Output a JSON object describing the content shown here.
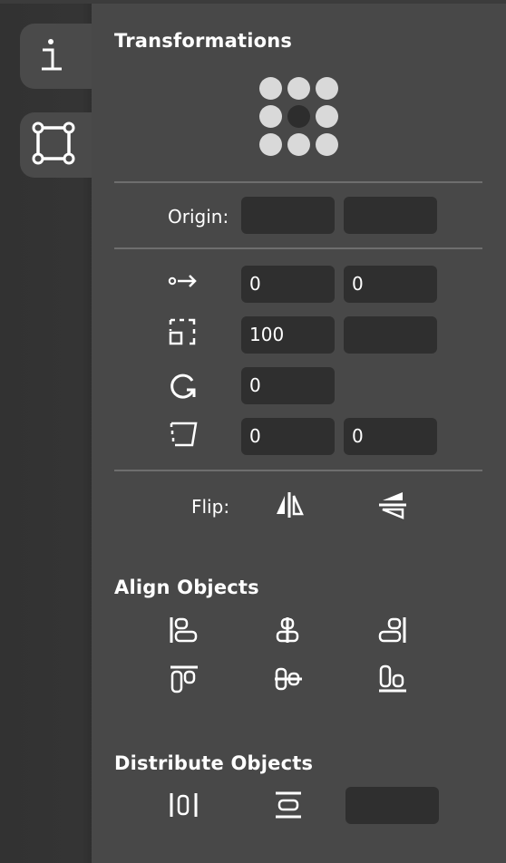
{
  "sidebar": {
    "tabs": [
      {
        "name": "info",
        "icon": "info-icon"
      },
      {
        "name": "transform",
        "icon": "transform-box-icon",
        "active": true
      }
    ]
  },
  "transformations": {
    "heading": "Transformations",
    "anchor_grid": {
      "selected": "center"
    },
    "origin": {
      "label": "Origin:",
      "x": "",
      "y": ""
    },
    "position": {
      "icon": "position-arrow-icon",
      "x": "0",
      "y": "0"
    },
    "scale": {
      "icon": "scale-icon",
      "width": "100",
      "height": ""
    },
    "rotate": {
      "icon": "rotate-icon",
      "value": "0"
    },
    "skew": {
      "icon": "skew-icon",
      "x": "0",
      "y": "0"
    },
    "flip": {
      "label": "Flip:",
      "horizontal_icon": "flip-horizontal-icon",
      "vertical_icon": "flip-vertical-icon"
    }
  },
  "align": {
    "heading": "Align Objects",
    "buttons": [
      "align-left-icon",
      "align-center-horizontal-icon",
      "align-right-icon",
      "align-top-icon",
      "align-center-vertical-icon",
      "align-bottom-icon"
    ]
  },
  "distribute": {
    "heading": "Distribute Objects",
    "buttons": [
      "distribute-horizontal-icon",
      "distribute-vertical-icon"
    ],
    "spacing": ""
  },
  "colors": {
    "panel": "#484848",
    "sidebar": "#323232",
    "field": "#2f2f2f",
    "divider": "#6e6e6e"
  }
}
